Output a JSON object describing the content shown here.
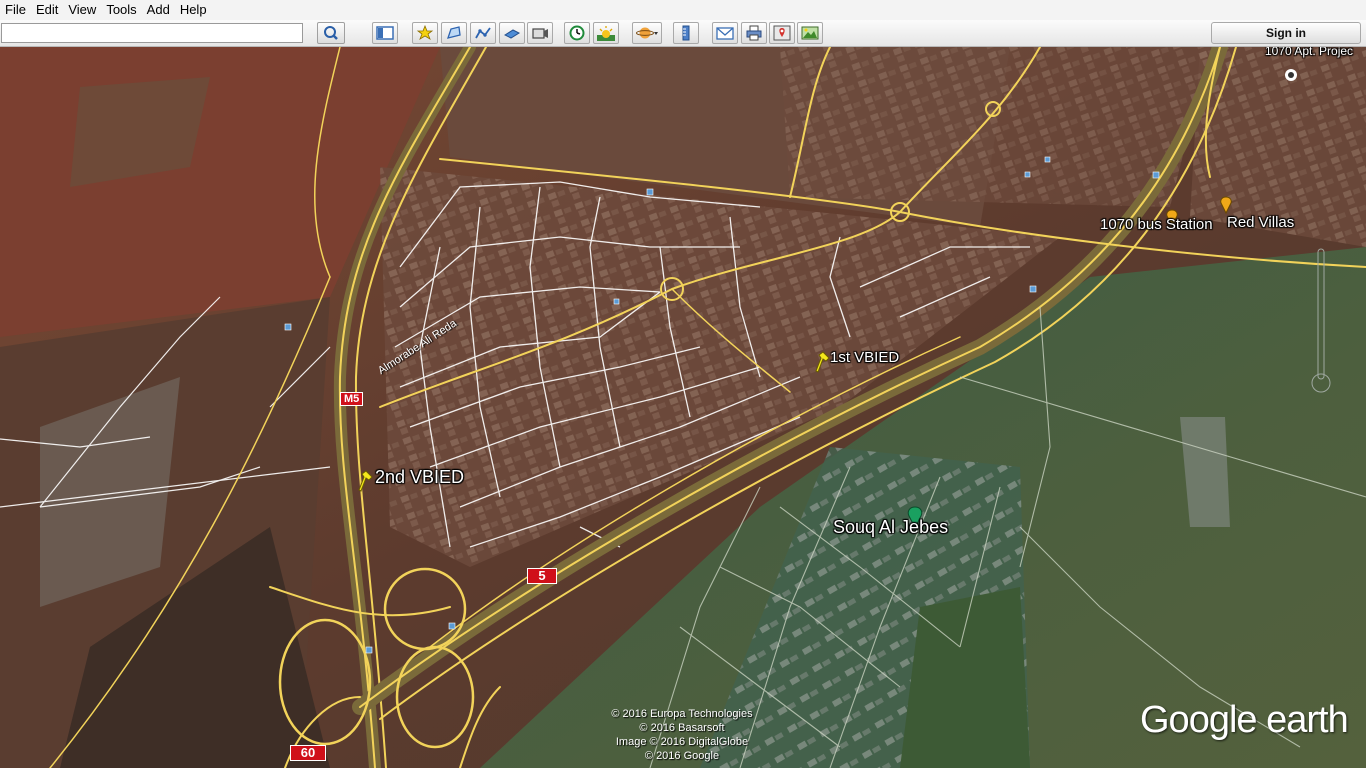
{
  "menu": [
    "File",
    "Edit",
    "View",
    "Tools",
    "Add",
    "Help"
  ],
  "search": {
    "value": "",
    "placeholder": ""
  },
  "toolbar": {
    "search_icon": "magnifier-icon",
    "buttons": [
      {
        "name": "sidebar-toggle",
        "icon": "sidebar-icon"
      },
      {
        "name": "add-placemark",
        "icon": "placemark-pin-icon"
      },
      {
        "name": "add-polygon",
        "icon": "polygon-icon"
      },
      {
        "name": "add-path",
        "icon": "path-icon"
      },
      {
        "name": "add-image-overlay",
        "icon": "image-overlay-icon"
      },
      {
        "name": "record-tour",
        "icon": "record-tour-icon"
      },
      {
        "name": "historical-imagery",
        "icon": "clock-icon"
      },
      {
        "name": "sunlight",
        "icon": "sun-icon"
      },
      {
        "name": "switch-planet",
        "icon": "planet-icon"
      },
      {
        "name": "ruler",
        "icon": "ruler-icon"
      },
      {
        "name": "email",
        "icon": "envelope-icon"
      },
      {
        "name": "print",
        "icon": "printer-icon"
      },
      {
        "name": "view-in-maps",
        "icon": "maps-icon"
      },
      {
        "name": "save-image",
        "icon": "save-image-icon"
      }
    ],
    "signin_label": "Sign in"
  },
  "map": {
    "placemarks": {
      "first_vbied": "1st VBIED",
      "second_vbied": "2nd VBIED",
      "souq": "Souq Al Jebes",
      "bus_station": "1070 bus Station",
      "red_villas": "Red Villas",
      "apt_project": "1070 Apt. Projec"
    },
    "street": "Almorabe Ali Reda",
    "shields": {
      "m5": "M5",
      "route5": "5",
      "route60": "60"
    },
    "colors": {
      "road_yellow": "#f2d35a",
      "street_white": "#ffffff",
      "shield_red": "#d0101a",
      "pin_yellow": "#f4e71c",
      "pin_green": "#1aa060"
    }
  },
  "copyright": [
    "© 2016 Europa Technologies",
    "© 2016 Basarsoft",
    "Image © 2016 DigitalGlobe",
    "© 2016 Google"
  ],
  "logo": "Google earth"
}
